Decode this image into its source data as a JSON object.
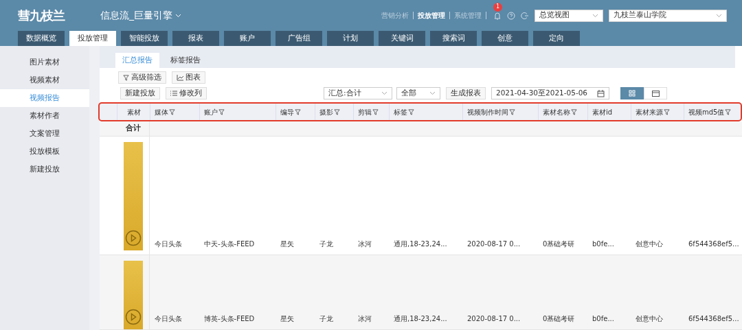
{
  "header": {
    "logo": "彗九枝兰",
    "title": "信息流_巨量引擎",
    "nav": [
      {
        "label": "营销分析",
        "selected": false
      },
      {
        "label": "投放管理",
        "selected": true
      },
      {
        "label": "系统管理",
        "selected": false
      }
    ],
    "notification_count": "1",
    "view_select": "总览视图",
    "org_select": "九枝兰泰山学院"
  },
  "tabs": [
    {
      "label": "数据概览",
      "selected": false
    },
    {
      "label": "投放管理",
      "selected": true
    },
    {
      "label": "智能投放",
      "selected": false
    },
    {
      "label": "报表",
      "selected": false
    },
    {
      "label": "账户",
      "selected": false
    },
    {
      "label": "广告组",
      "selected": false
    },
    {
      "label": "计划",
      "selected": false
    },
    {
      "label": "关键词",
      "selected": false
    },
    {
      "label": "搜索词",
      "selected": false
    },
    {
      "label": "创意",
      "selected": false
    },
    {
      "label": "定向",
      "selected": false
    }
  ],
  "sidebar": {
    "items": [
      {
        "label": "图片素材",
        "selected": false
      },
      {
        "label": "视频素材",
        "selected": false
      },
      {
        "label": "视频报告",
        "selected": true
      },
      {
        "label": "素材作者",
        "selected": false
      },
      {
        "label": "文案管理",
        "selected": false
      },
      {
        "label": "投放模板",
        "selected": false
      },
      {
        "label": "新建投放",
        "selected": false
      }
    ]
  },
  "report_tabs": [
    {
      "label": "汇总报告",
      "selected": true
    },
    {
      "label": "标签报告",
      "selected": false
    }
  ],
  "toolbar": {
    "filter_button": "高级筛选",
    "chart_button": "图表",
    "new_button": "新建投放",
    "columns_button": "修改列",
    "summary_select": "汇总:合计",
    "scope_select": "全部",
    "generate_button": "生成报表",
    "date_range": "2021-04-30至2021-05-06",
    "views": [
      {
        "kind": "grid",
        "selected": true
      },
      {
        "kind": "card",
        "selected": false
      }
    ]
  },
  "table": {
    "columns": [
      {
        "label": "素材",
        "filter": false
      },
      {
        "label": "媒体",
        "filter": true
      },
      {
        "label": "账户",
        "filter": true
      },
      {
        "label": "编导",
        "filter": true
      },
      {
        "label": "摄影",
        "filter": true
      },
      {
        "label": "剪辑",
        "filter": true
      },
      {
        "label": "标签",
        "filter": true
      },
      {
        "label": "视频制作时间",
        "filter": true
      },
      {
        "label": "素材名称",
        "filter": true
      },
      {
        "label": "素材id",
        "filter": false
      },
      {
        "label": "素材来源",
        "filter": true
      },
      {
        "label": "视频md5值",
        "filter": true
      }
    ],
    "total_label": "合计",
    "rows": [
      {
        "hovered": false,
        "cells": [
          "",
          "今日头条",
          "中天-头条-FEED",
          "星矢",
          "子龙",
          "冰河",
          "通用,18-23,24...",
          "2020-08-17 0...",
          "0基础考研",
          "b0fe...",
          "创意中心",
          "6f544368ef5..."
        ]
      },
      {
        "hovered": true,
        "cells": [
          "",
          "今日头条",
          "博英-头条-FEED",
          "星矢",
          "子龙",
          "冰河",
          "通用,18-23,24...",
          "2020-08-17 0...",
          "0基础考研",
          "b0fe...",
          "创意中心",
          "6f544368ef5..."
        ]
      }
    ]
  }
}
